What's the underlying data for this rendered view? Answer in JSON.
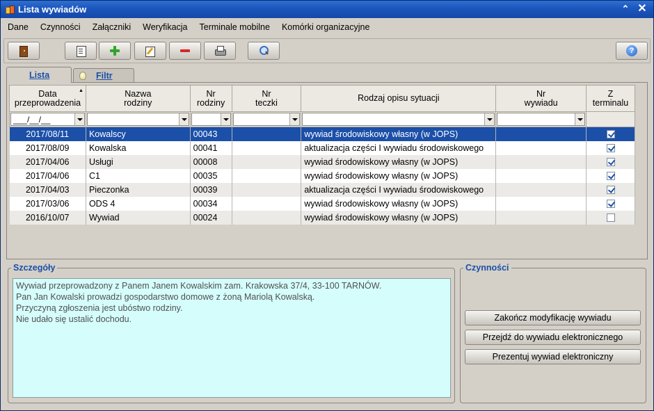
{
  "window": {
    "title": "Lista wywiadów"
  },
  "menu": [
    "Dane",
    "Czynności",
    "Załączniki",
    "Weryfikacja",
    "Terminale mobilne",
    "Komórki organizacyjne"
  ],
  "toolbar": {
    "icons": [
      "door-exit-icon",
      "document-view-icon",
      "plus-icon",
      "edit-icon",
      "minus-icon",
      "printer-icon",
      "magnifier-icon",
      "help-icon"
    ],
    "help_glyph": "?"
  },
  "tabs": {
    "list": "Lista",
    "filter": "Filtr"
  },
  "table": {
    "columns": [
      {
        "line1": "Data",
        "line2": "przeprowadzenia"
      },
      {
        "line1": "Nazwa",
        "line2": "rodziny"
      },
      {
        "line1": "Nr",
        "line2": "rodziny"
      },
      {
        "line1": "Nr",
        "line2": "teczki"
      },
      {
        "line1": "Rodzaj opisu sytuacji",
        "line2": ""
      },
      {
        "line1": "Nr",
        "line2": "wywiadu"
      },
      {
        "line1": "Z",
        "line2": "terminalu"
      }
    ],
    "date_filter_mask": "___/__/__",
    "rows": [
      {
        "date": "2017/08/11",
        "family": "Kowalscy",
        "family_no": "00043",
        "folder_no": "",
        "type": "wywiad środowiskowy własny (w JOPS)",
        "interview_no": "",
        "from_terminal": true
      },
      {
        "date": "2017/08/09",
        "family": "Kowalska",
        "family_no": "00041",
        "folder_no": "",
        "type": "aktualizacja części I wywiadu środowiskowego",
        "interview_no": "",
        "from_terminal": true
      },
      {
        "date": "2017/04/06",
        "family": "Usługi",
        "family_no": "00008",
        "folder_no": "",
        "type": "wywiad środowiskowy własny (w JOPS)",
        "interview_no": "",
        "from_terminal": true
      },
      {
        "date": "2017/04/06",
        "family": "C1",
        "family_no": "00035",
        "folder_no": "",
        "type": "wywiad środowiskowy własny (w JOPS)",
        "interview_no": "",
        "from_terminal": true
      },
      {
        "date": "2017/04/03",
        "family": "Pieczonka",
        "family_no": "00039",
        "folder_no": "",
        "type": "aktualizacja części I wywiadu środowiskowego",
        "interview_no": "",
        "from_terminal": true
      },
      {
        "date": "2017/03/06",
        "family": "ODS 4",
        "family_no": "00034",
        "folder_no": "",
        "type": "wywiad środowiskowy własny (w JOPS)",
        "interview_no": "",
        "from_terminal": true
      },
      {
        "date": "2016/10/07",
        "family": "Wywiad",
        "family_no": "00024",
        "folder_no": "",
        "type": "wywiad środowiskowy własny (w JOPS)",
        "interview_no": "",
        "from_terminal": false
      }
    ],
    "selected_row": 0
  },
  "details": {
    "title": "Szczegóły",
    "lines": [
      "Wywiad przeprowadzony z Panem Janem Kowalskim zam. Krakowska 37/4, 33-100 TARNÓW.",
      "Pan Jan Kowalski prowadzi gospodarstwo domowe z żoną Mariolą Kowalską.",
      "Przyczyną zgłoszenia jest ubóstwo rodziny.",
      "Nie udało się ustalić dochodu."
    ]
  },
  "actions": {
    "title": "Czynności",
    "buttons": [
      "Zakończ modyfikację wywiadu",
      "Przejdź do wywiadu elektronicznego",
      "Prezentuj wywiad elektroniczny"
    ]
  },
  "colors": {
    "title_bar": "#1b56bd",
    "selection": "#1b4fa8",
    "details_bg": "#d5fdfb",
    "group_title": "#1b4fa8"
  }
}
